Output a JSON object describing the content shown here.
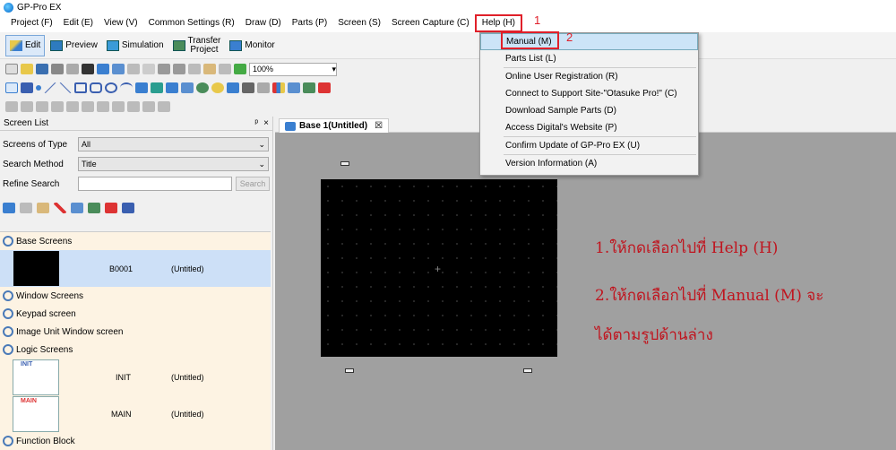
{
  "window": {
    "title": "GP-Pro EX"
  },
  "menu": [
    "Project (F)",
    "Edit (E)",
    "View (V)",
    "Common Settings (R)",
    "Draw (D)",
    "Parts (P)",
    "Screen (S)",
    "Screen Capture (C)",
    "Help (H)"
  ],
  "toolbar": {
    "edit": "Edit",
    "preview": "Preview",
    "simulation": "Simulation",
    "transfer_line1": "Transfer",
    "transfer_line2": "Project",
    "monitor": "Monitor",
    "zoom": "100%"
  },
  "help_menu": {
    "items": [
      "Manual (M)",
      "Parts List (L)",
      "Online User Registration (R)",
      "Connect to Support Site-\"Otasuke Pro!\" (C)",
      "Download Sample Parts (D)",
      "Access Digital's Website (P)",
      "Confirm Update of GP-Pro EX (U)",
      "Version Information (A)"
    ]
  },
  "annotation_numbers": [
    "1",
    "2"
  ],
  "screen_list": {
    "title": "Screen List",
    "pin": "ᵖ",
    "close": "×",
    "screens_of_type_label": "Screens of Type",
    "screens_of_type_value": "All",
    "search_method_label": "Search Method",
    "search_method_value": "Title",
    "refine_search_label": "Refine Search",
    "search_button": "Search",
    "categories": {
      "base": "Base Screens",
      "window": "Window Screens",
      "keypad": "Keypad screen",
      "image_unit": "Image Unit Window screen",
      "logic": "Logic Screens",
      "function_block": "Function Block"
    },
    "base_row": {
      "id": "B0001",
      "title": "(Untitled)"
    },
    "logic_rows": [
      {
        "thumb": "INIT",
        "id": "INIT",
        "title": "(Untitled)"
      },
      {
        "thumb": "MAIN",
        "id": "MAIN",
        "title": "(Untitled)"
      }
    ]
  },
  "editor": {
    "tab_label": "Base 1(Untitled)",
    "tab_close": "☒"
  },
  "instructions": {
    "line1": "1.ให้กดเลือกไปที่ Help (H)",
    "line2": "2.ให้กดเลือกไปที่ Manual (M) จะ",
    "line3": "ได้ตามรูปด้านล่าง"
  }
}
